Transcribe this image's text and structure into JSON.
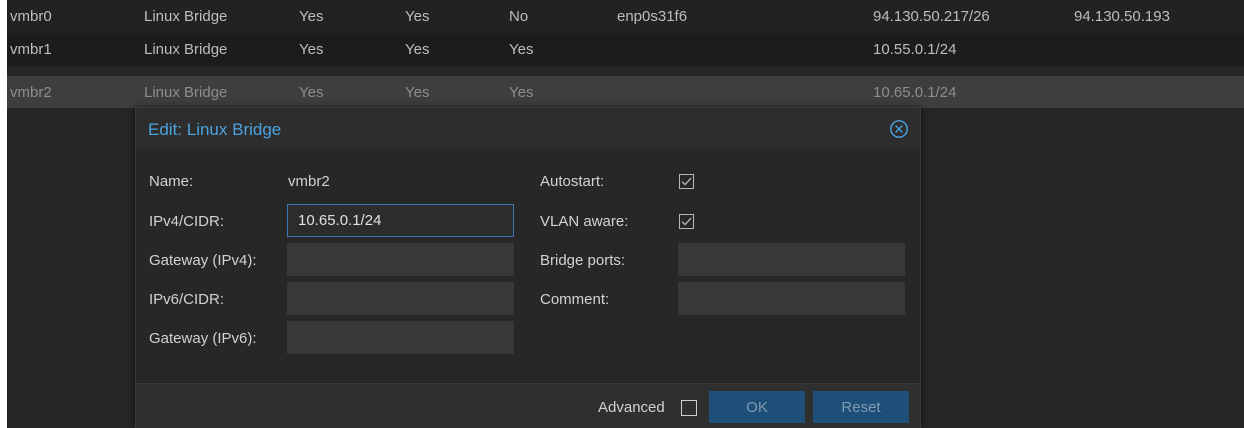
{
  "grid": {
    "rows": [
      {
        "name": "vmbr0",
        "type": "Linux Bridge",
        "active": "Yes",
        "autostart": "Yes",
        "vlan_aware": "No",
        "ports": "enp0s31f6",
        "cidr": "94.130.50.217/26",
        "gateway": "94.130.50.193"
      },
      {
        "name": "vmbr1",
        "type": "Linux Bridge",
        "active": "Yes",
        "autostart": "Yes",
        "vlan_aware": "Yes",
        "ports": "",
        "cidr": "10.55.0.1/24",
        "gateway": ""
      },
      {
        "name": "vmbr2",
        "type": "Linux Bridge",
        "active": "Yes",
        "autostart": "Yes",
        "vlan_aware": "Yes",
        "ports": "",
        "cidr": "10.65.0.1/24",
        "gateway": ""
      }
    ]
  },
  "dialog": {
    "title": "Edit: Linux Bridge",
    "close_icon": "close-circle-icon",
    "labels": {
      "name": "Name:",
      "ipv4": "IPv4/CIDR:",
      "gateway4": "Gateway (IPv4):",
      "ipv6": "IPv6/CIDR:",
      "gateway6": "Gateway (IPv6):",
      "autostart": "Autostart:",
      "vlan": "VLAN aware:",
      "ports": "Bridge ports:",
      "comment": "Comment:"
    },
    "values": {
      "name": "vmbr2",
      "ipv4": "10.65.0.1/24",
      "gateway4": "",
      "ipv6": "",
      "gateway6": "",
      "ports": "",
      "comment": "",
      "autostart_checked": true,
      "vlan_checked": true
    },
    "footer": {
      "advanced_label": "Advanced",
      "advanced_checked": false,
      "ok_label": "OK",
      "reset_label": "Reset"
    }
  },
  "colors": {
    "accent": "#4aa3df",
    "button": "#1e4f78",
    "focus_border": "#3d78b4",
    "background": "#252525"
  }
}
